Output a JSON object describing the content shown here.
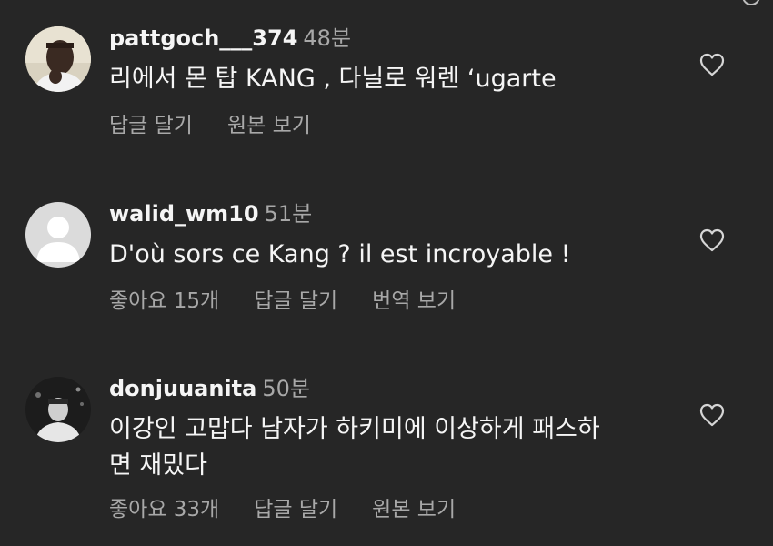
{
  "comments": [
    {
      "username": "pattgoch___374",
      "time": "48분",
      "lines": [
        "리에서 몬 탑 KANG , 다닐로 워렌 ‘ugarte"
      ],
      "actions": [
        "답글 달기",
        "원본 보기"
      ],
      "avatar": "profile-photo"
    },
    {
      "username": "walid_wm10",
      "time": "51분",
      "lines": [
        "D'où sors ce Kang ? il est incroyable !"
      ],
      "actions": [
        "좋아요 15개",
        "답글 달기",
        "번역 보기"
      ],
      "avatar": "default-profile"
    },
    {
      "username": "donjuuanita",
      "time": "50분",
      "lines": [
        "이강인 고맙다 남자가 하키미에 이상하게 패스하",
        "면 재밌다"
      ],
      "actions": [
        "좋아요 33개",
        "답글 달기",
        "원본 보기"
      ],
      "avatar": "profile-photo"
    }
  ],
  "icons": {
    "like": "heart-outline-icon",
    "top_edge": "circle-icon"
  },
  "colors": {
    "background": "#262626",
    "primary_text": "#f5f5f5",
    "secondary_text": "#a8a8a8"
  }
}
